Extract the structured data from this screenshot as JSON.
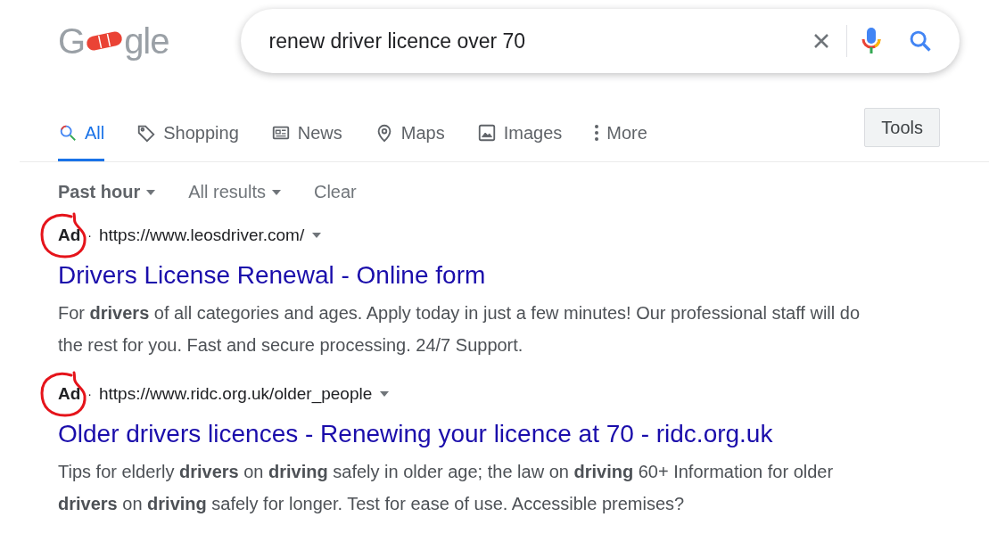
{
  "logo": {
    "left": "G",
    "right": "gle"
  },
  "search": {
    "value": "renew driver licence over 70"
  },
  "tabs": [
    {
      "label": "All",
      "kind": "search",
      "selected": true
    },
    {
      "label": "Shopping",
      "kind": "tag",
      "selected": false
    },
    {
      "label": "News",
      "kind": "news",
      "selected": false
    },
    {
      "label": "Maps",
      "kind": "pin",
      "selected": false
    },
    {
      "label": "Images",
      "kind": "image",
      "selected": false
    },
    {
      "label": "More",
      "kind": "dots",
      "selected": false
    }
  ],
  "tools_button": "Tools",
  "filters": [
    {
      "label": "Past hour",
      "selected": true,
      "kind": "dropdown"
    },
    {
      "label": "All results",
      "selected": false,
      "kind": "dropdown"
    },
    {
      "label": "Clear",
      "selected": false,
      "kind": "link"
    }
  ],
  "results": [
    {
      "ad_label": "Ad",
      "separator": "·",
      "url": "https://www.leosdriver.com/",
      "title": "Drivers License Renewal - Online form",
      "snippet": "For **drivers** of all categories and ages. Apply today in just a few minutes! Our professional staff will do the rest for you. Fast and secure processing. 24/7 Support.",
      "circled": true
    },
    {
      "ad_label": "Ad",
      "separator": "·",
      "url": "https://www.ridc.org.uk/older_people",
      "title": "Older drivers licences - Renewing your licence at 70 - ridc.org.uk",
      "snippet": "Tips for elderly **drivers** on **driving** safely in older age; the law on **driving** 60+ Information for older **drivers** on **driving** safely for longer. Test for ease of use. Accessible premises?",
      "circled": true
    }
  ]
}
